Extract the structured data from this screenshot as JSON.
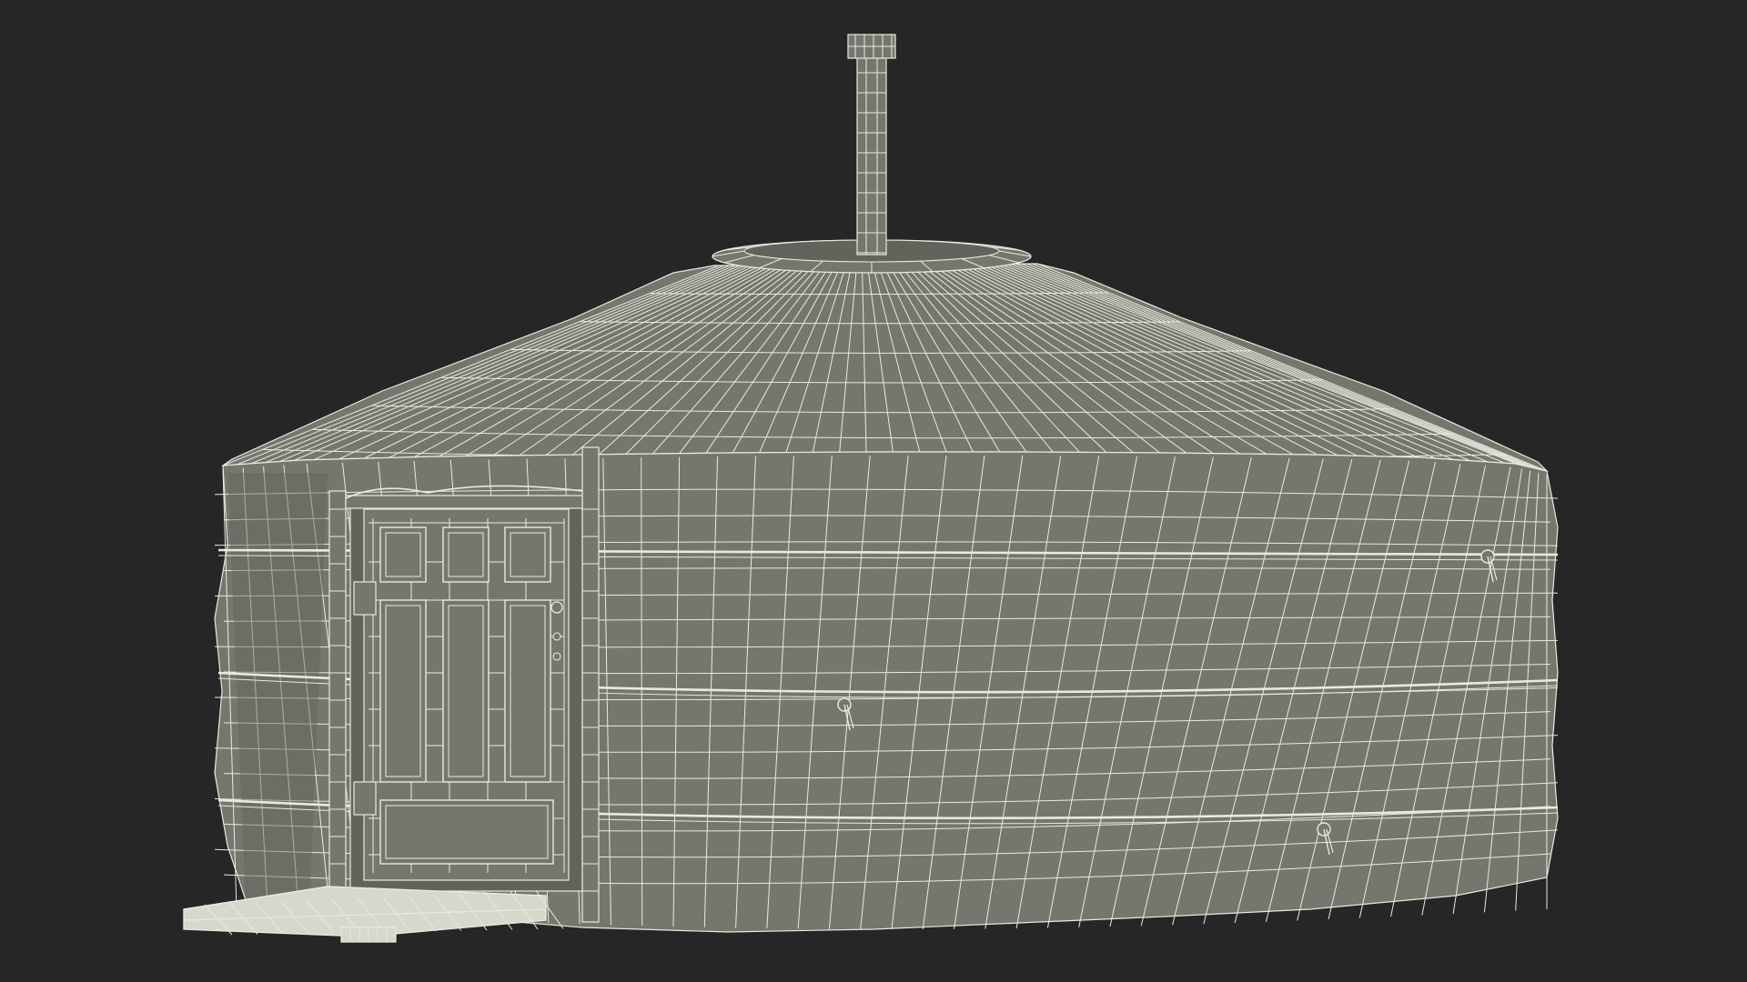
{
  "scene": {
    "background_color": "#262626",
    "surface_color": "#75766d",
    "surface_shadow_color": "#62635b",
    "wire_color": "#e9eadf",
    "deck_color": "#d7d8cd",
    "objects": [
      "yurt",
      "chimney-pipe",
      "roof-crown",
      "conical-roof",
      "felt-wall",
      "wall-straps",
      "entrance-door",
      "door-frame",
      "entrance-deck"
    ]
  }
}
